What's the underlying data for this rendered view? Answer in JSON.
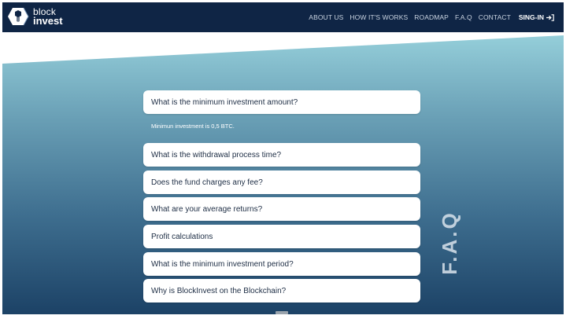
{
  "brand": {
    "line1": "block",
    "line2": "invest"
  },
  "nav": {
    "links": [
      "ABOUT US",
      "HOW IT'S WORKS",
      "ROADMAP",
      "F.A.Q",
      "CONTACT"
    ],
    "signin": "SING-IN"
  },
  "faq": {
    "section_label": "F.A.Q",
    "items": [
      {
        "question": "What is the minimum investment amount?",
        "answer": "Minimun investment is 0,5 BTC."
      },
      {
        "question": "What is the withdrawal process time?"
      },
      {
        "question": "Does the fund charges any fee?"
      },
      {
        "question": "What are your average returns?"
      },
      {
        "question": "Profit calculations"
      },
      {
        "question": "What is the minimum investment period?"
      },
      {
        "question": "Why is BlockInvest on the Blockchain?"
      }
    ]
  },
  "colors": {
    "navbar": "#0f2545",
    "hero_top": "#96d0db",
    "hero_bottom": "#1c4266",
    "card": "#ffffff"
  },
  "icons": [
    "logo-hexagon-icon",
    "sign-in-icon"
  ]
}
